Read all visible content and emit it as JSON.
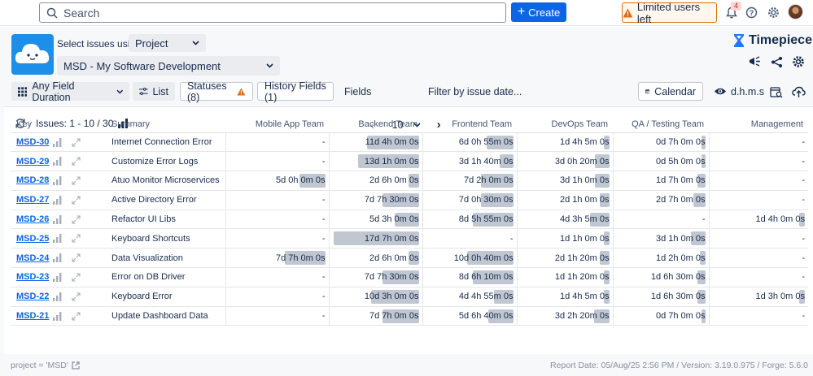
{
  "topbar": {
    "search_placeholder": "Search",
    "create_label": "Create",
    "limited_label": "Limited users left",
    "notification_count": "4"
  },
  "app": {
    "select_issues_label": "Select issues using",
    "select_mode": "Project",
    "project": "MSD - My Software Development",
    "brand": "Timepiece"
  },
  "toolbar": {
    "duration_label": "Any Field Duration",
    "list_label": "List",
    "statuses_label": "Statuses (8)",
    "history_label": "History Fields (1)",
    "fields_label": "Fields",
    "filter_label": "Filter by issue date...",
    "calendar_label": "Calendar",
    "format_label": "d.h.m.s"
  },
  "pager": {
    "issues_label": "Issues: 1 - 10 / 30",
    "page_size": "10"
  },
  "table": {
    "columns": [
      "Key",
      "Summary",
      "Mobile App Team",
      "Backend Team",
      "Frontend Team",
      "DevOps Team",
      "QA / Testing Team",
      "Management"
    ],
    "rows": [
      {
        "key": "MSD-30",
        "summary": "Internet Connection Error",
        "cells": [
          "-",
          "11d 4h 0m 0s",
          "6d 0h 55m 0s",
          "1d 4h 5m 0s",
          "0d 7h 0m 0s",
          "-"
        ],
        "fills": [
          0,
          0.6,
          0.31,
          0.06,
          0.04,
          0
        ]
      },
      {
        "key": "MSD-29",
        "summary": "Customize Error Logs",
        "cells": [
          "-",
          "13d 1h 0m 0s",
          "3d 1h 40m 0s",
          "3d 0h 20m 0s",
          "0d 5h 0m 0s",
          "-"
        ],
        "fills": [
          0,
          0.7,
          0.16,
          0.16,
          0.03,
          0
        ]
      },
      {
        "key": "MSD-28",
        "summary": "Atuo Monitor Microservices",
        "cells": [
          "5d 0h 0m 0s",
          "2d 6h 0m 0s",
          "7d 2h 0m 0s",
          "3d 1h 0m 0s",
          "1d 7h 0m 0s",
          "-"
        ],
        "fills": [
          0.27,
          0.12,
          0.37,
          0.16,
          0.09,
          0
        ]
      },
      {
        "key": "MSD-27",
        "summary": "Active Directory Error",
        "cells": [
          "-",
          "7d 7h 30m 0s",
          "7d 0h 30m 0s",
          "2d 1h 0m 0s",
          "2d 7h 0m 0s",
          "-"
        ],
        "fills": [
          0,
          0.42,
          0.37,
          0.11,
          0.14,
          0
        ]
      },
      {
        "key": "MSD-26",
        "summary": "Refactor UI Libs",
        "cells": [
          "-",
          "5d 3h 0m 0s",
          "8d 5h 55m 0s",
          "4d 3h 5m 0s",
          "-",
          "1d 4h 0m 0s"
        ],
        "fills": [
          0,
          0.28,
          0.46,
          0.22,
          0,
          0.06
        ]
      },
      {
        "key": "MSD-25",
        "summary": "Keyboard Shortcuts",
        "cells": [
          "-",
          "17d 7h 0m 0s",
          "-",
          "1d 1h 0m 0s",
          "3d 1h 0m 0s",
          "-"
        ],
        "fills": [
          0,
          0.98,
          0,
          0.06,
          0.16,
          0
        ]
      },
      {
        "key": "MSD-24",
        "summary": "Data Visualization",
        "cells": [
          "7d 7h 0m 0s",
          "2d 6h 0m 0s",
          "10d 0h 40m 0s",
          "2d 1h 20m 0s",
          "1d 2h 0m 0s",
          "-"
        ],
        "fills": [
          0.42,
          0.12,
          0.53,
          0.11,
          0.06,
          0
        ]
      },
      {
        "key": "MSD-23",
        "summary": "Error on DB Driver",
        "cells": [
          "-",
          "7d 7h 30m 0s",
          "8d 6h 10m 0s",
          "1d 1h 20m 0s",
          "1d 6h 30m 0s",
          "-"
        ],
        "fills": [
          0,
          0.42,
          0.46,
          0.06,
          0.09,
          0
        ]
      },
      {
        "key": "MSD-22",
        "summary": "Keyboard Error",
        "cells": [
          "-",
          "10d 3h 0m 0s",
          "4d 4h 55m 0s",
          "1d 4h 5m 0s",
          "1d 6h 30m 0s",
          "1d 3h 0m 0s"
        ],
        "fills": [
          0,
          0.55,
          0.22,
          0.06,
          0.09,
          0.06
        ]
      },
      {
        "key": "MSD-21",
        "summary": "Update Dashboard Data",
        "cells": [
          "-",
          "7d 7h 0m 0s",
          "5d 6h 40m 0s",
          "3d 2h 20m 0s",
          "0d 7h 0m 0s",
          "-"
        ],
        "fills": [
          0,
          0.42,
          0.29,
          0.17,
          0.04,
          0
        ]
      }
    ]
  },
  "footer": {
    "query": "project = 'MSD'",
    "report": "Report Date: 05/Aug/25 2:56 PM / Version: 3.19.0.975 / Forge: 5.6.0"
  },
  "colors": {
    "primary": "#0c66e4",
    "bar": "#c1c7d0",
    "warning": "#d97008"
  }
}
